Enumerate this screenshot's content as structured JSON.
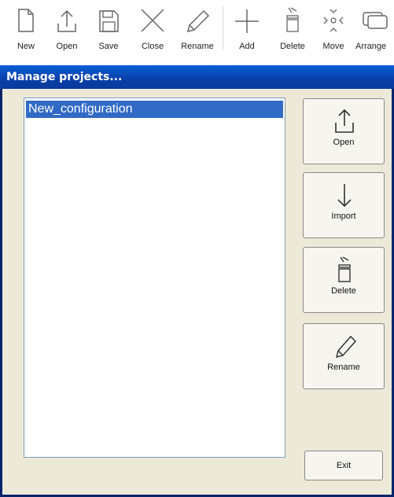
{
  "toolbar": {
    "items": [
      {
        "label": "New",
        "icon": "new-file-icon"
      },
      {
        "label": "Open",
        "icon": "open-upload-icon"
      },
      {
        "label": "Save",
        "icon": "save-icon"
      },
      {
        "label": "Close",
        "icon": "close-icon"
      },
      {
        "label": "Rename",
        "icon": "pencil-icon"
      },
      {
        "label": "Add",
        "icon": "plus-icon"
      },
      {
        "label": "Delete",
        "icon": "trash-icon"
      },
      {
        "label": "Move",
        "icon": "move-icon"
      },
      {
        "label": "Arrange",
        "icon": "arrange-icon"
      }
    ]
  },
  "dialog": {
    "title": "Manage projects...",
    "projects": [
      "New_configuration"
    ],
    "buttons": {
      "open": "Open",
      "import": "Import",
      "delete": "Delete",
      "rename": "Rename",
      "exit": "Exit"
    }
  },
  "colors": {
    "titlebar": "#0a46b8",
    "selection": "#316ac5",
    "window_bg": "#ece9d8"
  }
}
